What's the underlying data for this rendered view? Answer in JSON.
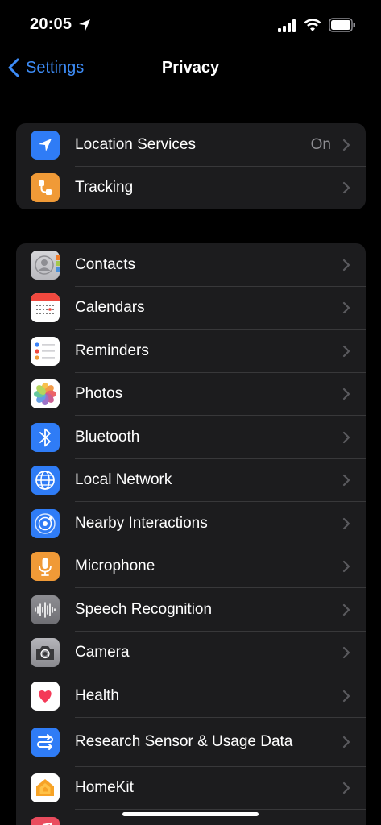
{
  "status_bar": {
    "time": "20:05",
    "icons": [
      "location-arrow-icon",
      "cellular-signal-icon",
      "wifi-icon",
      "battery-icon"
    ]
  },
  "nav": {
    "back_label": "Settings",
    "title": "Privacy"
  },
  "group1": {
    "items": [
      {
        "label": "Location Services",
        "value": "On",
        "icon": "location-arrow-icon",
        "color": "#2f7cf6"
      },
      {
        "label": "Tracking",
        "value": "",
        "icon": "tracking-icon",
        "color": "#f09a37"
      }
    ]
  },
  "group2": {
    "items": [
      {
        "label": "Contacts",
        "icon": "contacts-icon",
        "color": "#c8c8cc"
      },
      {
        "label": "Calendars",
        "icon": "calendar-icon",
        "color": "#ffffff"
      },
      {
        "label": "Reminders",
        "icon": "reminders-icon",
        "color": "#ffffff"
      },
      {
        "label": "Photos",
        "icon": "photos-icon",
        "color": "#ffffff"
      },
      {
        "label": "Bluetooth",
        "icon": "bluetooth-icon",
        "color": "#2f7cf6"
      },
      {
        "label": "Local Network",
        "icon": "globe-icon",
        "color": "#2f7cf6"
      },
      {
        "label": "Nearby Interactions",
        "icon": "nearby-interactions-icon",
        "color": "#2f7cf6"
      },
      {
        "label": "Microphone",
        "icon": "microphone-icon",
        "color": "#f09a37"
      },
      {
        "label": "Speech Recognition",
        "icon": "waveform-icon",
        "color": "#8e8e93"
      },
      {
        "label": "Camera",
        "icon": "camera-icon",
        "color": "#8e8e93"
      },
      {
        "label": "Health",
        "icon": "heart-icon",
        "color": "#ffffff"
      },
      {
        "label": "Research Sensor & Usage Data",
        "icon": "research-icon",
        "color": "#2f7cf6"
      },
      {
        "label": "HomeKit",
        "icon": "homekit-icon",
        "color": "#ffffff"
      },
      {
        "label": "",
        "icon": "music-icon",
        "color": "#ea4c5e"
      }
    ]
  },
  "colors": {
    "background": "#000000",
    "cell": "#1c1c1e",
    "accent": "#3d8cf7",
    "secondary_text": "#8e8e93"
  }
}
